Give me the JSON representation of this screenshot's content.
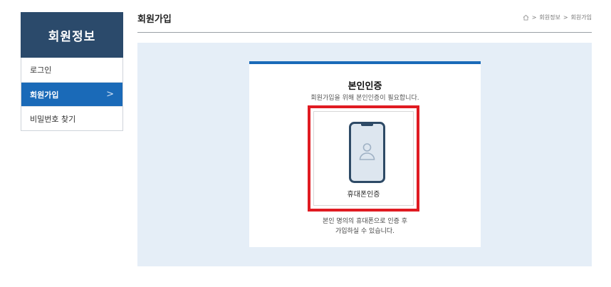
{
  "sidebar": {
    "title": "회원정보",
    "items": [
      {
        "label": "로그인",
        "active": false
      },
      {
        "label": "회원가입",
        "active": true,
        "chevron": ">"
      },
      {
        "label": "비밀번호 찾기",
        "active": false
      }
    ]
  },
  "header": {
    "title": "회원가입",
    "breadcrumb": [
      ">",
      "회원정보",
      ">",
      "회원가입"
    ]
  },
  "card": {
    "title": "본인인증",
    "subtitle": "회원가입을 위해 본인인증이 필요합니다.",
    "option_label": "휴대폰인증",
    "note_line1": "본인 명의의 휴대폰으로 인증 후",
    "note_line2": "가입하실 수 있습니다."
  },
  "colors": {
    "sidebar_header": "#2b4a6b",
    "active_item": "#1a6ab8",
    "highlight_border": "#e01b22",
    "content_bg": "#e5eef7"
  },
  "icons": [
    "home-icon",
    "chevron-right-icon",
    "mobile-phone-icon",
    "user-icon"
  ]
}
